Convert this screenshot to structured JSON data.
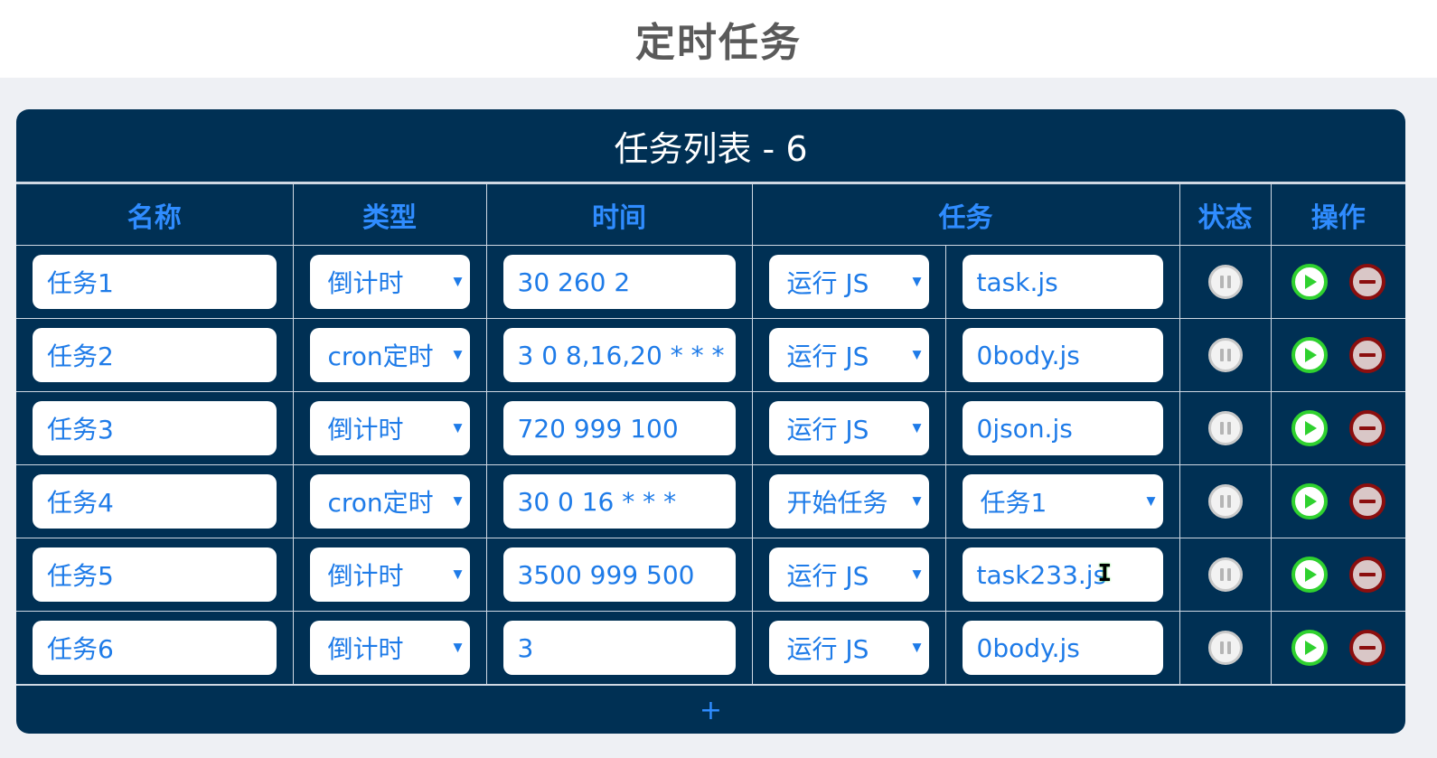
{
  "page_title": "定时任务",
  "panel_title": "任务列表 - 6",
  "columns": {
    "name": "名称",
    "type": "类型",
    "time": "时间",
    "task": "任务",
    "status": "状态",
    "ops": "操作"
  },
  "rows": [
    {
      "name": "任务1",
      "type": "倒计时",
      "time": "30 260 2",
      "action": "运行 JS",
      "target": "task.js",
      "target_is_select": false
    },
    {
      "name": "任务2",
      "type": "cron定时",
      "time": "3 0 8,16,20 * * *",
      "action": "运行 JS",
      "target": "0body.js",
      "target_is_select": false
    },
    {
      "name": "任务3",
      "type": "倒计时",
      "time": "720 999 100",
      "action": "运行 JS",
      "target": "0json.js",
      "target_is_select": false
    },
    {
      "name": "任务4",
      "type": "cron定时",
      "time": "30 0 16 * * *",
      "action": "开始任务",
      "target": "任务1",
      "target_is_select": true
    },
    {
      "name": "任务5",
      "type": "倒计时",
      "time": "3500 999 500",
      "action": "运行 JS",
      "target": "task233.js",
      "target_is_select": false
    },
    {
      "name": "任务6",
      "type": "倒计时",
      "time": "3",
      "action": "运行 JS",
      "target": "0body.js",
      "target_is_select": false
    }
  ],
  "add_label": "+",
  "icons": {
    "caret": "caret-down-icon",
    "status": "pause-icon",
    "run": "play-icon",
    "delete": "minus-circle-icon",
    "cursor": "text-cursor-icon"
  },
  "colors": {
    "panel_bg": "#003054",
    "accent_blue": "#2f8cff",
    "run_green": "#2fd12f",
    "delete_red": "#8b0e0e"
  }
}
